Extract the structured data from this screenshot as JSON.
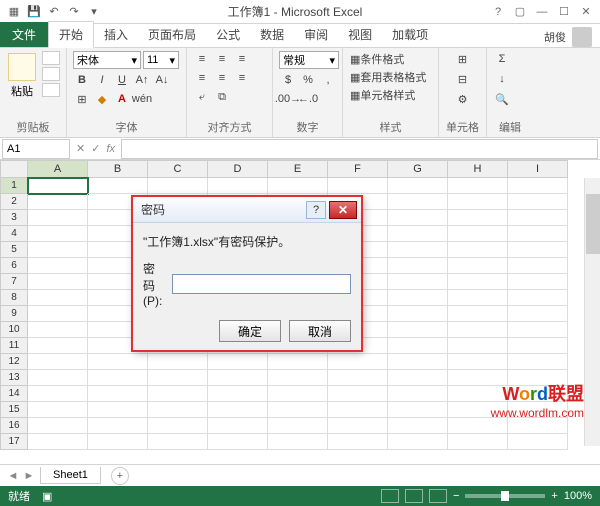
{
  "titlebar": {
    "title": "工作簿1 - Microsoft Excel"
  },
  "user": {
    "name": "胡俊"
  },
  "ribbon": {
    "file": "文件",
    "tabs": [
      "开始",
      "插入",
      "页面布局",
      "公式",
      "数据",
      "审阅",
      "视图",
      "加载项"
    ],
    "active_tab": "开始",
    "clipboard": {
      "paste": "粘贴",
      "label": "剪贴板"
    },
    "font": {
      "name": "宋体",
      "size": "11",
      "label": "字体"
    },
    "align": {
      "label": "对齐方式"
    },
    "number": {
      "format": "常规",
      "label": "数字"
    },
    "styles": {
      "cond": "条件格式",
      "table": "套用表格格式",
      "cell": "单元格样式",
      "label": "样式"
    },
    "cells": {
      "label": "单元格"
    },
    "editing": {
      "label": "编辑"
    }
  },
  "formula": {
    "name_box": "A1",
    "fx": "fx"
  },
  "grid": {
    "cols": [
      "A",
      "B",
      "C",
      "D",
      "E",
      "F",
      "G",
      "H",
      "I"
    ],
    "rows": [
      1,
      2,
      3,
      4,
      5,
      6,
      7,
      8,
      9,
      10,
      11,
      12,
      13,
      14,
      15,
      16,
      17
    ],
    "selected": "A1"
  },
  "sheets": {
    "active": "Sheet1"
  },
  "statusbar": {
    "status": "就绪",
    "zoom": "100%"
  },
  "dialog": {
    "title": "密码",
    "message": "\"工作簿1.xlsx\"有密码保护。",
    "pwd_label": "密码(P):",
    "ok": "确定",
    "cancel": "取消"
  },
  "watermark": {
    "line1_parts": [
      "W",
      "o",
      "r",
      "d",
      "联盟"
    ],
    "line2": "www.wordlm.com"
  }
}
